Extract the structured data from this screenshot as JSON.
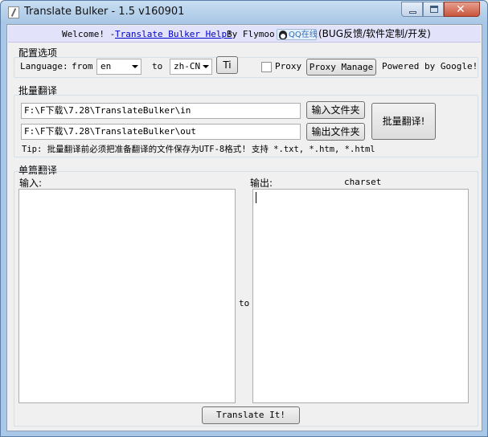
{
  "window": {
    "title": "Translate Bulker - 1.5 v160901"
  },
  "welcome_bar": {
    "prefix": "Welcome! - ",
    "help_link": "Translate Bulker Help!",
    "by": "By Flymoo",
    "qq_badge": "QQ在线",
    "suffix": "(BUG反馈/软件定制/开发)"
  },
  "config": {
    "group_title": "配置选项",
    "language_label": "Language:",
    "from_label": "from",
    "from_value": "en",
    "to_label": "to",
    "to_value": "zh-CN",
    "ti_button": "Ti",
    "proxy_label": "Proxy",
    "proxy_checked": false,
    "proxy_manage_button": "Proxy Manage",
    "powered_by": "Powered by Google!"
  },
  "batch": {
    "group_title": "批量翻译",
    "input_path": "F:\\F下载\\7.28\\TranslateBulker\\in",
    "output_path": "F:\\F下载\\7.28\\TranslateBulker\\out",
    "input_folder_button": "输入文件夹",
    "output_folder_button": "输出文件夹",
    "batch_translate_button": "批量翻译!",
    "tip": "Tip: 批量翻译前必须把准备翻译的文件保存为UTF-8格式! 支持 *.txt, *.htm, *.html"
  },
  "single": {
    "group_title": "单篇翻译",
    "input_label": "输入:",
    "output_label": "输出:",
    "charset_label": "charset",
    "to_label": "to",
    "input_text": "",
    "output_text": "",
    "translate_button": "Translate It!"
  }
}
